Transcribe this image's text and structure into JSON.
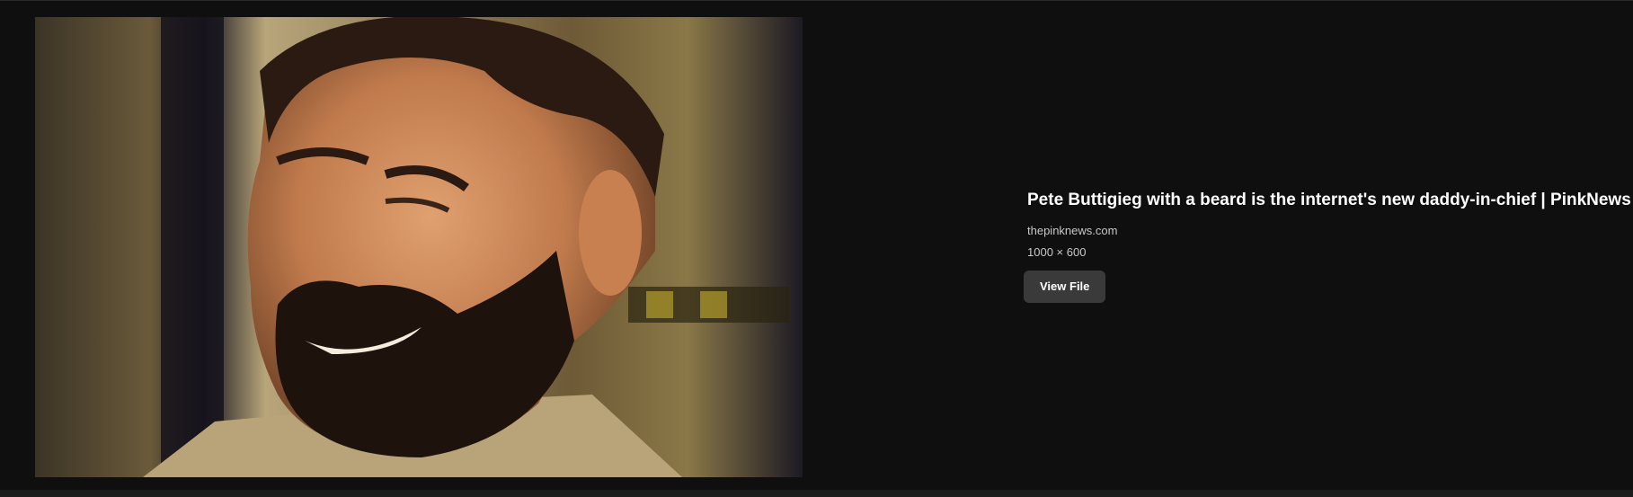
{
  "preview": {
    "image_description": "photo-preview"
  },
  "result": {
    "title": "Pete Buttigieg with a beard is the internet's new daddy-in-chief | PinkNews",
    "source": "thepinknews.com",
    "dimensions": "1000 × 600",
    "view_file_label": "View File"
  }
}
